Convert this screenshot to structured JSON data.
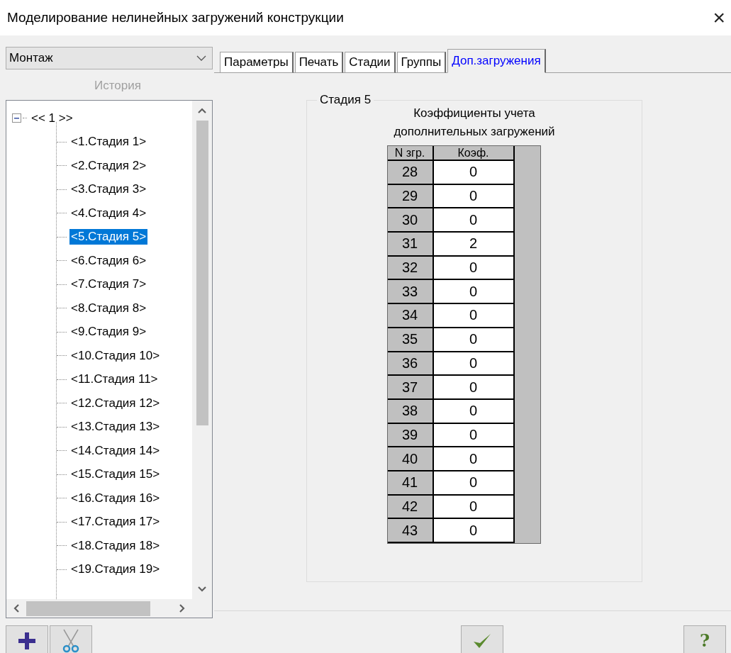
{
  "window": {
    "title": "Моделирование нелинейных загружений конструкции",
    "close": "×"
  },
  "mode_select": {
    "value": "Монтаж"
  },
  "history_label": {
    "text": "История",
    "disabled": true
  },
  "tree": {
    "label": "<< 1 >>",
    "expanded": true,
    "children": [
      {
        "label": "<1.Стадия 1>",
        "selected": false
      },
      {
        "label": "<2.Стадия 2>",
        "selected": false
      },
      {
        "label": "<3.Стадия 3>",
        "selected": false
      },
      {
        "label": "<4.Стадия 4>",
        "selected": false
      },
      {
        "label": "<5.Стадия 5>",
        "selected": true
      },
      {
        "label": "<6.Стадия 6>",
        "selected": false
      },
      {
        "label": "<7.Стадия 7>",
        "selected": false
      },
      {
        "label": "<8.Стадия 8>",
        "selected": false
      },
      {
        "label": "<9.Стадия 9>",
        "selected": false
      },
      {
        "label": "<10.Стадия 10>",
        "selected": false
      },
      {
        "label": "<11.Стадия 11>",
        "selected": false
      },
      {
        "label": "<12.Стадия 12>",
        "selected": false
      },
      {
        "label": "<13.Стадия 13>",
        "selected": false
      },
      {
        "label": "<14.Стадия 14>",
        "selected": false
      },
      {
        "label": "<15.Стадия 15>",
        "selected": false
      },
      {
        "label": "<16.Стадия 16>",
        "selected": false
      },
      {
        "label": "<17.Стадия 17>",
        "selected": false
      },
      {
        "label": "<18.Стадия 18>",
        "selected": false
      },
      {
        "label": "<19.Стадия 19>",
        "selected": false
      }
    ]
  },
  "tabs": [
    {
      "label": "Параметры",
      "selected": false
    },
    {
      "label": "Печать",
      "selected": false
    },
    {
      "label": "Стадии",
      "selected": false
    },
    {
      "label": "Группы",
      "selected": false
    },
    {
      "label": "Доп.загружения",
      "selected": true
    }
  ],
  "group": {
    "title": "Стадия 5",
    "caption_line_1": "Коэффициенты учета",
    "caption_line_2": "дополнительных загружений"
  },
  "table": {
    "columns": [
      "N згр.",
      "Коэф."
    ],
    "rows": [
      [
        "28",
        "0"
      ],
      [
        "29",
        "0"
      ],
      [
        "30",
        "0"
      ],
      [
        "31",
        "2"
      ],
      [
        "32",
        "0"
      ],
      [
        "33",
        "0"
      ],
      [
        "34",
        "0"
      ],
      [
        "35",
        "0"
      ],
      [
        "36",
        "0"
      ],
      [
        "37",
        "0"
      ],
      [
        "38",
        "0"
      ],
      [
        "39",
        "0"
      ],
      [
        "40",
        "0"
      ],
      [
        "41",
        "0"
      ],
      [
        "42",
        "0"
      ],
      [
        "43",
        "0"
      ]
    ]
  },
  "help_button": {
    "label": "?"
  }
}
